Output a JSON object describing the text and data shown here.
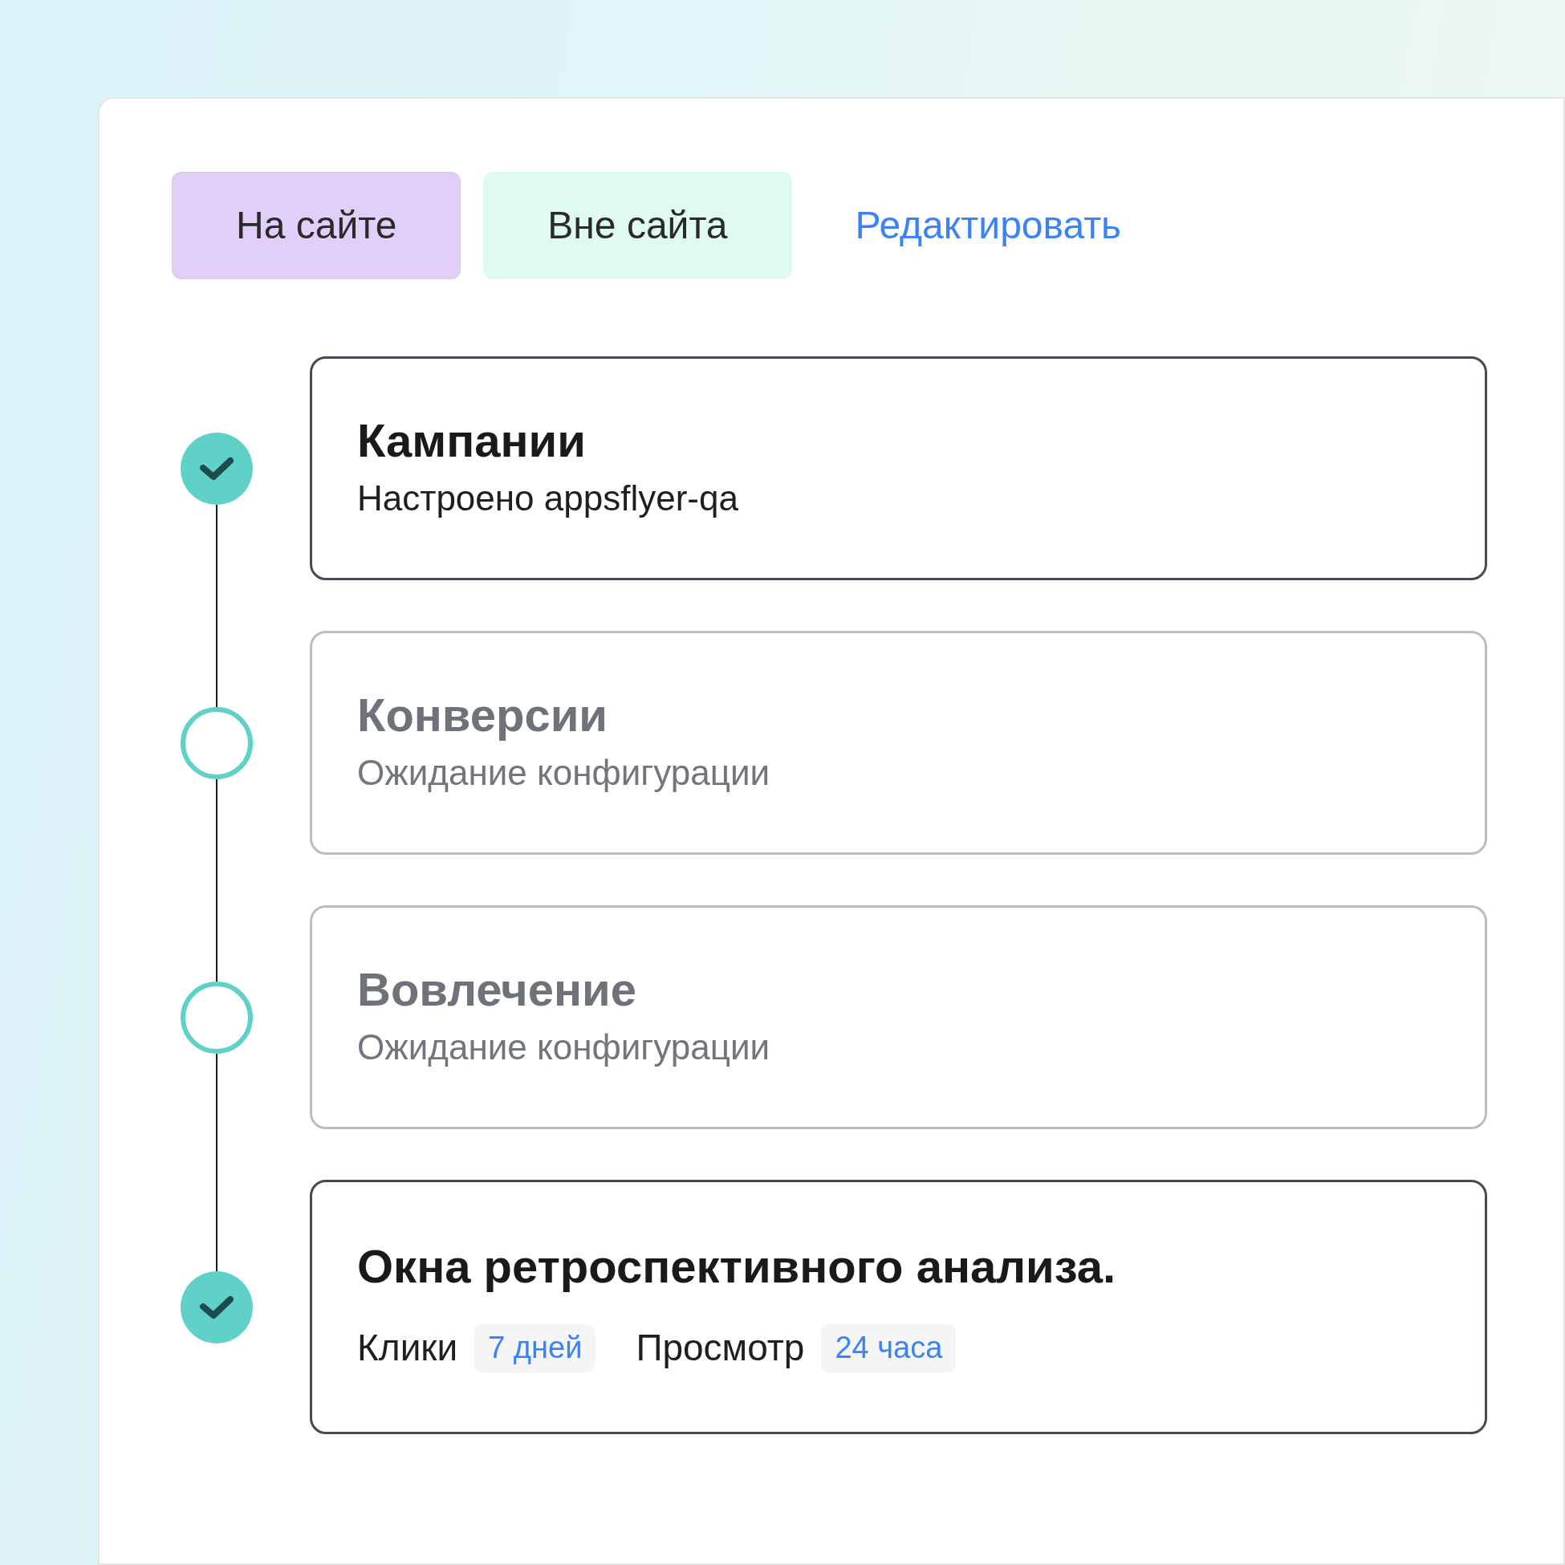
{
  "tabs": [
    {
      "label": "На сайте",
      "selected": true,
      "color": "#e1cffa"
    },
    {
      "label": "Вне сайта",
      "selected": false,
      "color": "#dffaf2"
    }
  ],
  "edit_link": {
    "label": "Редактировать"
  },
  "steps": [
    {
      "kind": "status",
      "title": "Кампании",
      "subtitle": "Настроено appsflyer-qa",
      "completed": true
    },
    {
      "kind": "status",
      "title": "Конверсии",
      "subtitle": "Ожидание конфигурации",
      "completed": false
    },
    {
      "kind": "status",
      "title": "Вовлечение",
      "subtitle": "Ожидание конфигурации",
      "completed": false
    },
    {
      "kind": "windows",
      "title": "Окна ретроспективного анализа.",
      "completed": true,
      "windows": [
        {
          "label": "Клики",
          "value": "7 дней"
        },
        {
          "label": "Просмотр",
          "value": "24 часа"
        }
      ]
    }
  ]
}
